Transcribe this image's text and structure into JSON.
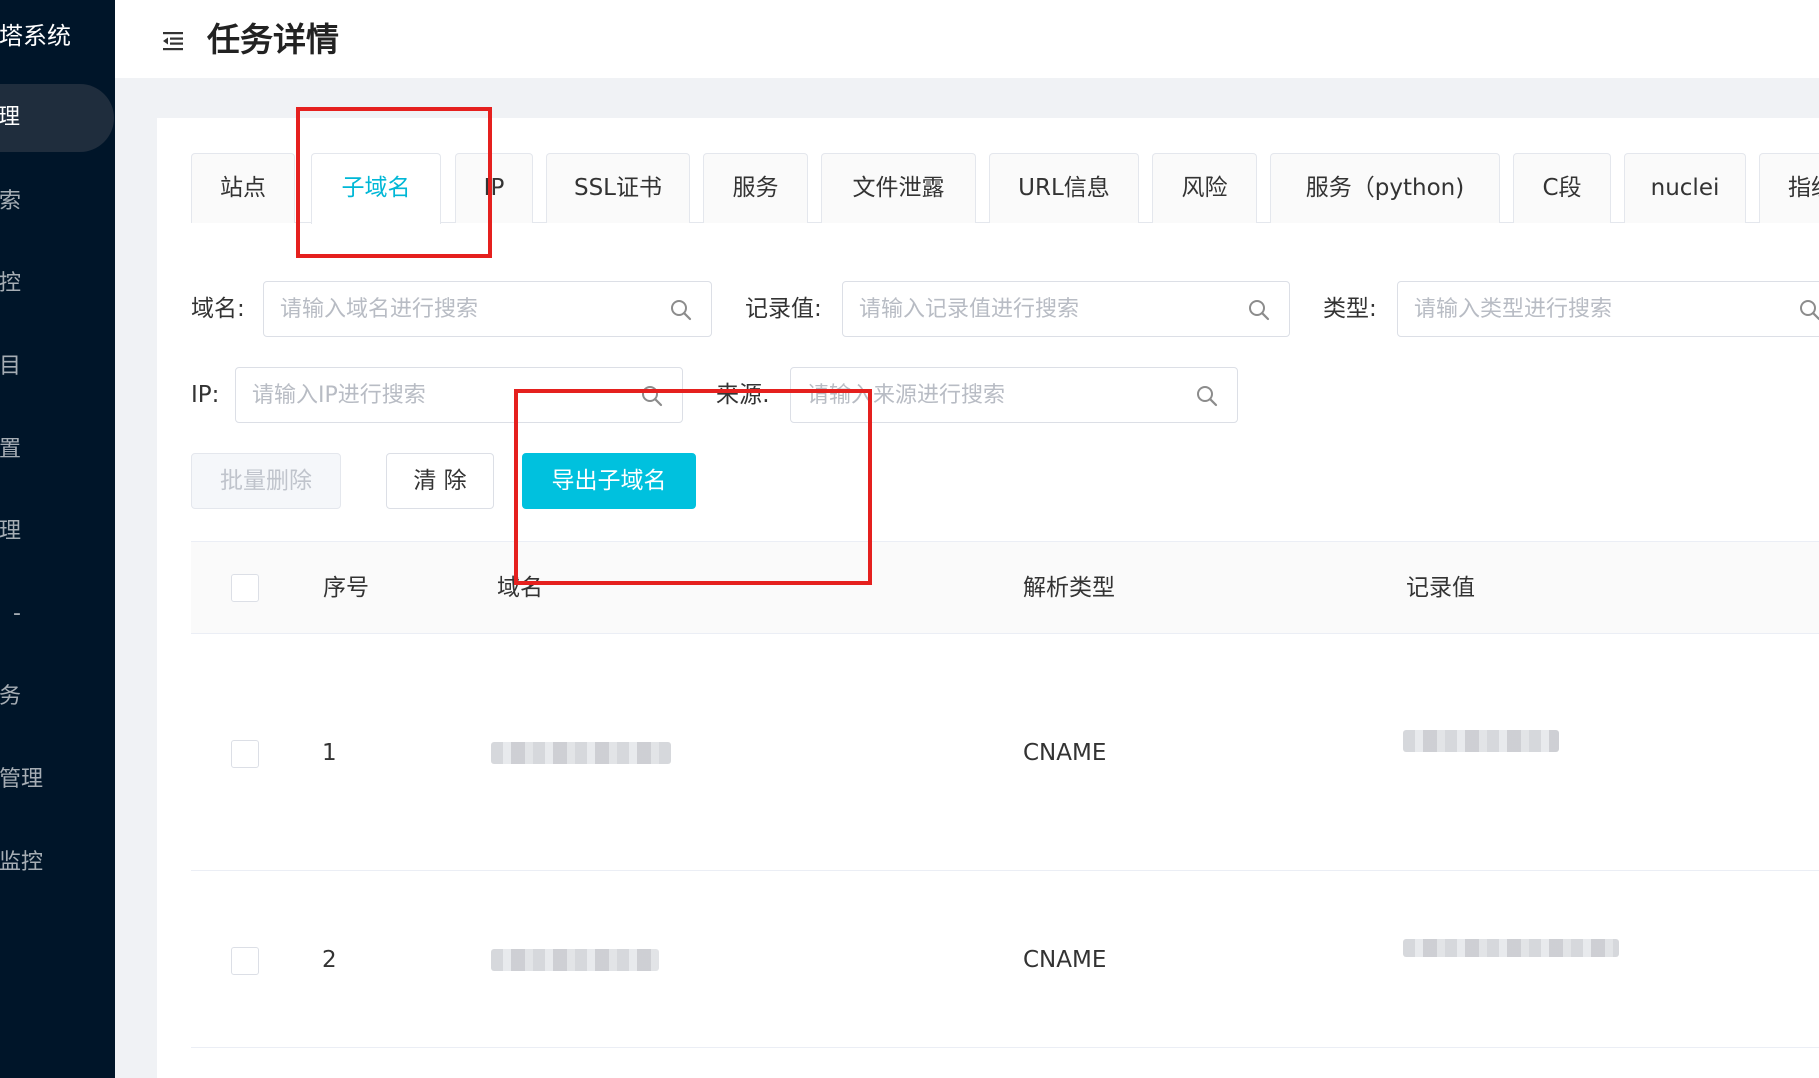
{
  "sidebar": {
    "brand": "塔系统",
    "items": [
      {
        "label": "理",
        "active": true
      },
      {
        "label": "索"
      },
      {
        "label": "控"
      },
      {
        "label": "目"
      },
      {
        "label": "置"
      },
      {
        "label": "理"
      },
      {
        "label": "-"
      },
      {
        "label": "务"
      },
      {
        "label": "管理"
      },
      {
        "label": "监控"
      }
    ]
  },
  "header": {
    "title": "任务详情"
  },
  "tabs": [
    {
      "label": "站点"
    },
    {
      "label": "子域名",
      "active": true
    },
    {
      "label": "IP"
    },
    {
      "label": "SSL证书"
    },
    {
      "label": "服务"
    },
    {
      "label": "文件泄露"
    },
    {
      "label": "URL信息"
    },
    {
      "label": "风险"
    },
    {
      "label": "服务（python)"
    },
    {
      "label": "C段"
    },
    {
      "label": "nuclei"
    },
    {
      "label": "指纹"
    }
  ],
  "filters": {
    "domain": {
      "label": "域名:",
      "placeholder": "请输入域名进行搜索"
    },
    "record": {
      "label": "记录值:",
      "placeholder": "请输入记录值进行搜索"
    },
    "type": {
      "label": "类型:",
      "placeholder": "请输入类型进行搜索"
    },
    "ip": {
      "label": "IP:",
      "placeholder": "请输入IP进行搜索"
    },
    "source": {
      "label": "来源:",
      "placeholder": "请输入来源进行搜索"
    }
  },
  "actions": {
    "batch_delete": "批量删除",
    "clear": "清 除",
    "export": "导出子域名"
  },
  "table": {
    "columns": {
      "index": "序号",
      "domain": "域名",
      "type": "解析类型",
      "record": "记录值"
    },
    "rows": [
      {
        "index": "1",
        "type": "CNAME"
      },
      {
        "index": "2",
        "type": "CNAME"
      }
    ]
  },
  "colors": {
    "sidebar_bg": "#001529",
    "accent": "#00c1de",
    "annotation": "#e5201e"
  }
}
